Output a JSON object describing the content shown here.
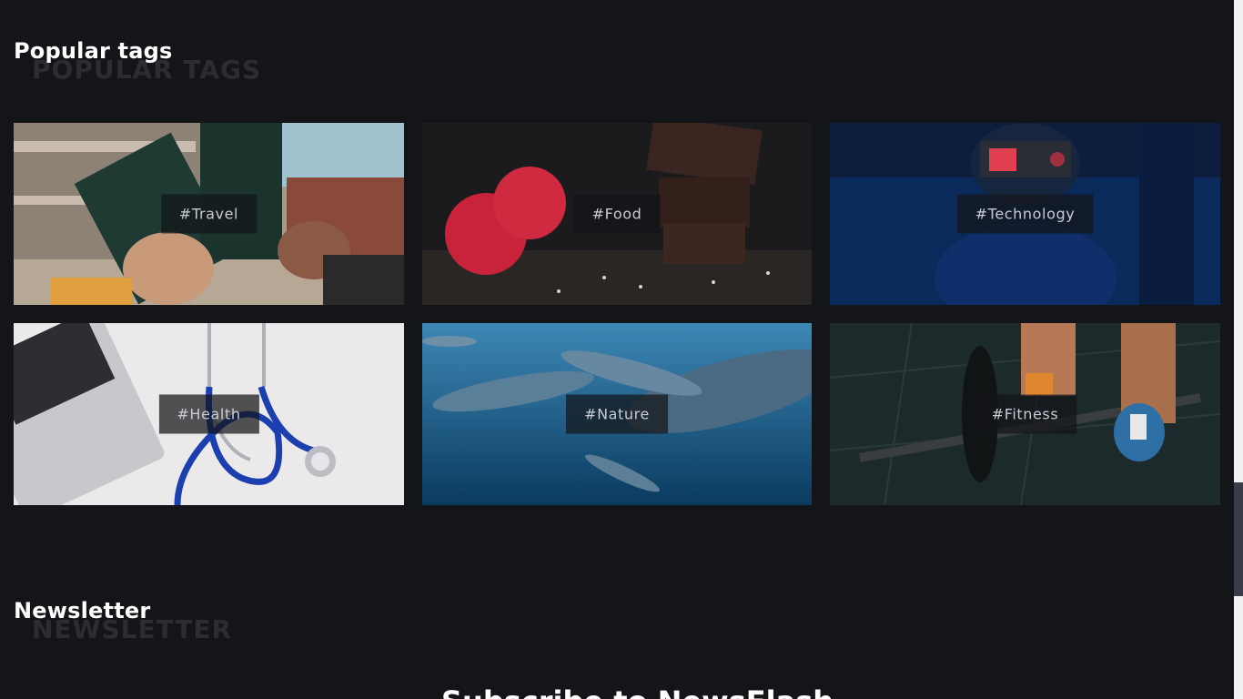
{
  "popular_tags": {
    "title": "Popular tags",
    "ghost_title": "POPULAR TAGS",
    "tags": [
      {
        "label": "#Travel",
        "image": "passports-in-hands"
      },
      {
        "label": "#Food",
        "image": "raspberries-and-chocolate"
      },
      {
        "label": "#Technology",
        "image": "vr-headset-person"
      },
      {
        "label": "#Health",
        "image": "stethoscope-and-laptop"
      },
      {
        "label": "#Nature",
        "image": "dolphins-underwater"
      },
      {
        "label": "#Fitness",
        "image": "barbell-deadlift"
      }
    ]
  },
  "newsletter": {
    "title": "Newsletter",
    "ghost_title": "NEWSLETTER",
    "heading": "Subscribe to NewsFlash"
  },
  "colors": {
    "background": "#141519",
    "ghost_text": "#2b2d33",
    "tag_label_text": "#c9cbd3",
    "scrollbar_thumb": "#3a3c4a"
  }
}
